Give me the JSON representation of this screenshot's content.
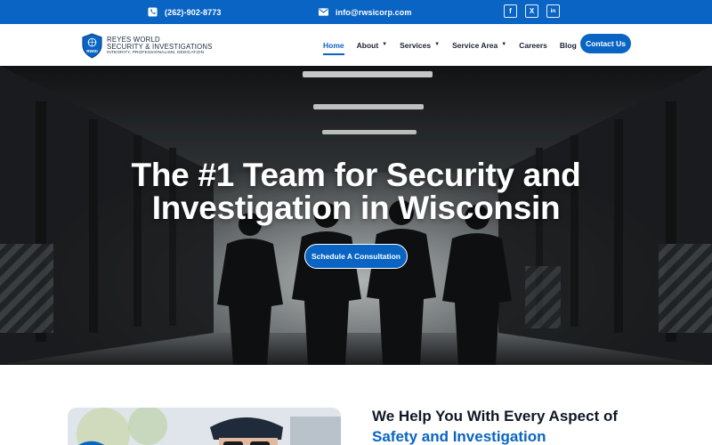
{
  "topbar": {
    "phone": "(262)-902-8773",
    "email": "info@rwsicorp.com",
    "icons": {
      "phone": "phone-icon",
      "email": "mail-icon"
    },
    "socials": [
      {
        "name": "facebook-icon",
        "glyph": "f"
      },
      {
        "name": "x-twitter-icon",
        "glyph": "X"
      },
      {
        "name": "linkedin-icon",
        "glyph": "in"
      }
    ]
  },
  "header": {
    "logo": {
      "badge": "RWSI",
      "line1": "REYES WORLD",
      "line2": "SECURITY & INVESTIGATIONS",
      "line3": "INTEGRITY, PROFESSIONALISM, DEDICATION"
    },
    "nav": [
      {
        "label": "Home",
        "active": true,
        "dropdown": false
      },
      {
        "label": "About",
        "active": false,
        "dropdown": true
      },
      {
        "label": "Services",
        "active": false,
        "dropdown": true
      },
      {
        "label": "Service Area",
        "active": false,
        "dropdown": true
      },
      {
        "label": "Careers",
        "active": false,
        "dropdown": false
      },
      {
        "label": "Blog",
        "active": false,
        "dropdown": false
      }
    ],
    "contact_button": "Contact Us"
  },
  "hero": {
    "title_line1": "The #1 Team for Security and",
    "title_line2": "Investigation in Wisconsin",
    "button": "Schedule A Consultation"
  },
  "section": {
    "heading_line1": "We Help You With Every Aspect of",
    "heading_line2": "Safety and Investigation"
  },
  "colors": {
    "brand": "#0a64c4",
    "dark": "#101827",
    "white": "#ffffff"
  }
}
